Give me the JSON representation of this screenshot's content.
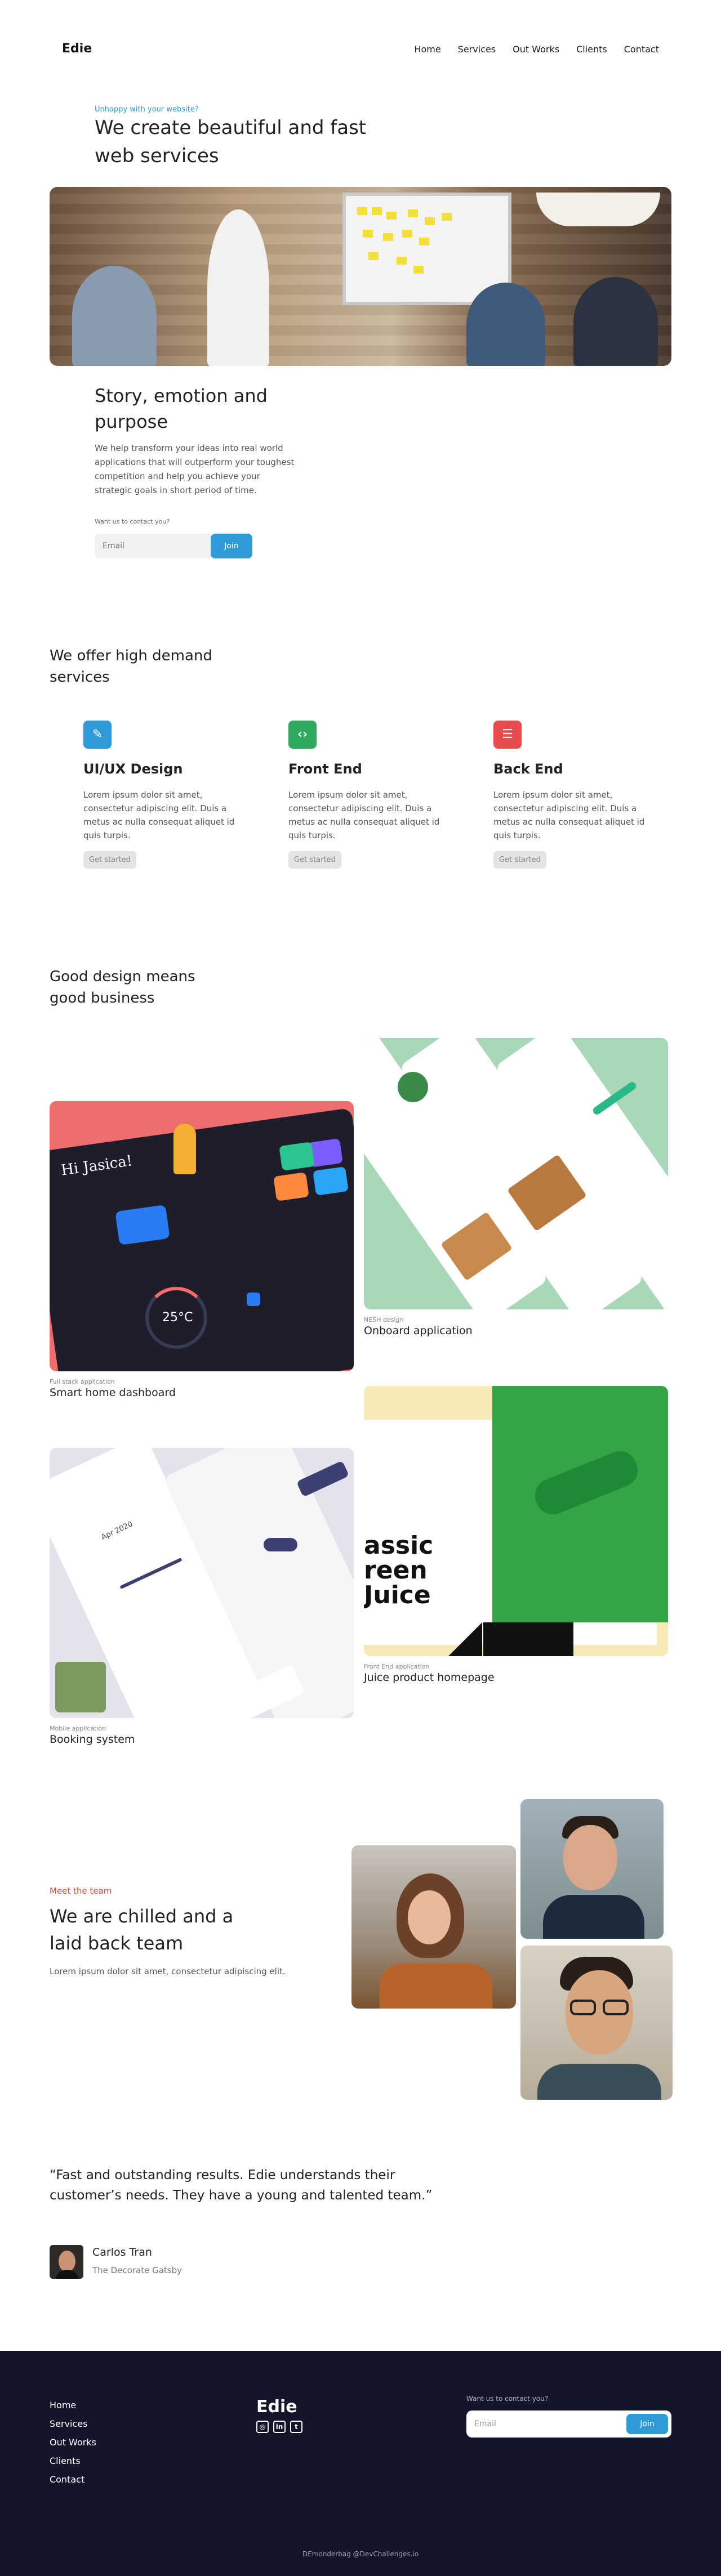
{
  "header": {
    "logo": "Edie",
    "nav": [
      "Home",
      "Services",
      "Out Works",
      "Clients",
      "Contact"
    ]
  },
  "hero": {
    "eyebrow": "Unhappy with your website?",
    "title": "We create beautiful and fast web services"
  },
  "story": {
    "title": "Story, emotion and purpose",
    "text": "We help transform your ideas into real world applications that will outperform your toughest competition and help you achieve your strategic goals in short period of time.",
    "contact_label": "Want us to contact you?",
    "email_placeholder": "Email",
    "join_label": "Join"
  },
  "services": {
    "title": "We offer high demand services",
    "items": [
      {
        "name": "UI/UX Design",
        "icon": "pencil-icon",
        "color": "#2e9bd8",
        "text": "Lorem ipsum dolor sit amet, consectetur adipiscing elit. Duis a metus ac nulla consequat aliquet id quis turpis.",
        "cta": "Get started"
      },
      {
        "name": "Front End",
        "icon": "code-icon",
        "color": "#2daa5c",
        "text": "Lorem ipsum dolor sit amet, consectetur adipiscing elit. Duis a metus ac nulla consequat aliquet id quis turpis.",
        "cta": "Get started"
      },
      {
        "name": "Back End",
        "icon": "server-icon",
        "color": "#e74c4c",
        "text": "Lorem ipsum dolor sit amet, consectetur adipiscing elit. Duis a metus ac nulla consequat aliquet id quis turpis.",
        "cta": "Get started"
      }
    ]
  },
  "portfolio": {
    "title": "Good design means good business",
    "works": [
      {
        "category": "NESH design",
        "name": "Onboard application"
      },
      {
        "category": "Full stack application",
        "name": "Smart home dashboard"
      },
      {
        "category": "Front End application",
        "name": "Juice product homepage"
      },
      {
        "category": "Mobile application",
        "name": "Booking system"
      }
    ],
    "smart_home_greeting": "Hi Jasica!",
    "smart_home_temp": "25°C",
    "juice_text": "assic reen Juice",
    "booking_month": "Apr 2020"
  },
  "team": {
    "eyebrow": "Meet the team",
    "title": "We are chilled and a laid back team",
    "text": "Lorem ipsum dolor sit amet, consectetur adipiscing elit."
  },
  "testimonial": {
    "quote": "“Fast and outstanding results. Edie understands their customer’s needs. They have a young and talented team.”",
    "name": "Carlos Tran",
    "company": "The Decorate Gatsby"
  },
  "footer": {
    "nav": [
      "Home",
      "Services",
      "Out Works",
      "Clients",
      "Contact"
    ],
    "logo": "Edie",
    "social": [
      "instagram-icon",
      "linkedin-icon",
      "twitter-icon"
    ],
    "contact_label": "Want us to contact you?",
    "email_placeholder": "Email",
    "join_label": "Join",
    "credit": "DEmonderbag @DevChallenges.io"
  }
}
